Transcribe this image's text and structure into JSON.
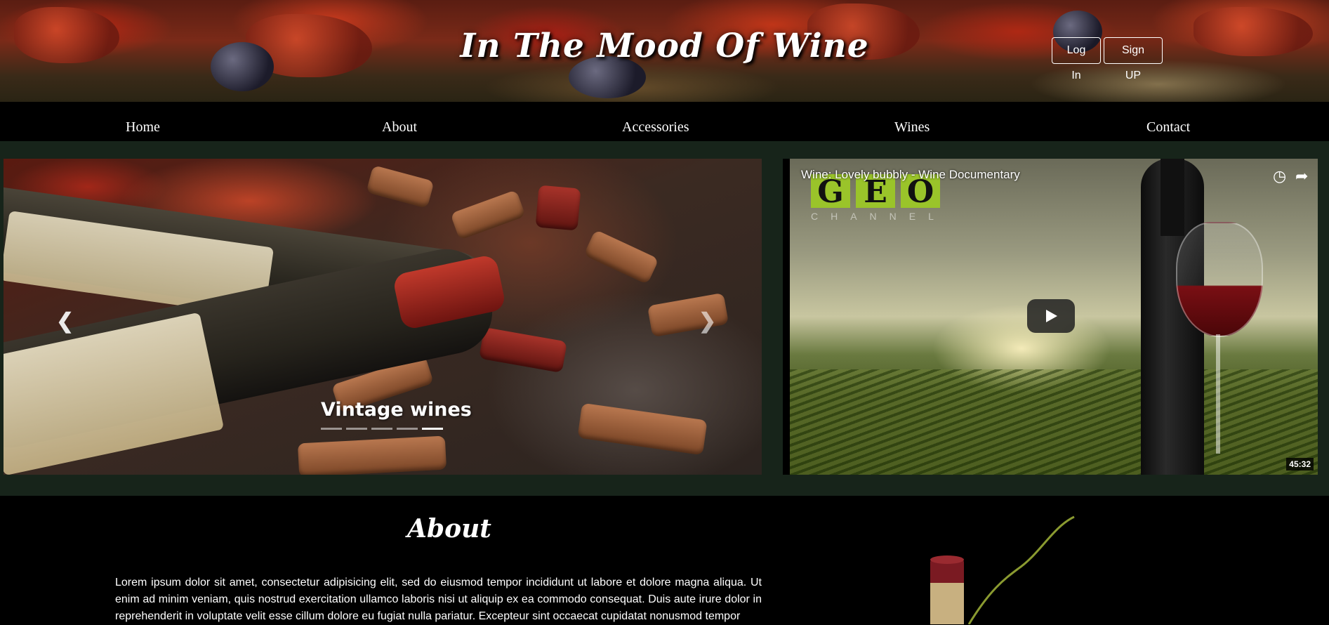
{
  "header": {
    "title": "In The Mood Of Wine",
    "login_label": "Log In",
    "signup_label": "Sign UP"
  },
  "nav": {
    "items": [
      "Home",
      "About",
      "Accessories",
      "Wines",
      "Contact"
    ]
  },
  "carousel": {
    "caption": "Vintage wines",
    "slide_count": 5,
    "active_slide": 5,
    "prev_icon": "chevron-left-icon",
    "next_icon": "chevron-right-icon"
  },
  "video": {
    "title": "Wine: Lovely bubbly - Wine Documentary",
    "channel_logo": "GEO",
    "duration": "45:32",
    "icons": [
      "clock-icon",
      "share-icon",
      "play-icon"
    ]
  },
  "about": {
    "heading": "About",
    "text": "Lorem ipsum dolor sit amet, consectetur adipisicing elit, sed do eiusmod tempor incididunt ut labore et dolore magna aliqua. Ut enim ad minim veniam, quis nostrud exercitation ullamco laboris nisi ut aliquip ex ea commodo consequat. Duis aute irure dolor in reprehenderit in voluptate velit esse cillum dolore eu fugiat nulla pariatur. Excepteur sint occaecat cupidatat nonusmod tempor"
  },
  "colors": {
    "band_background": "#17241a",
    "nav_background": "#000000",
    "text": "#ffffff"
  }
}
